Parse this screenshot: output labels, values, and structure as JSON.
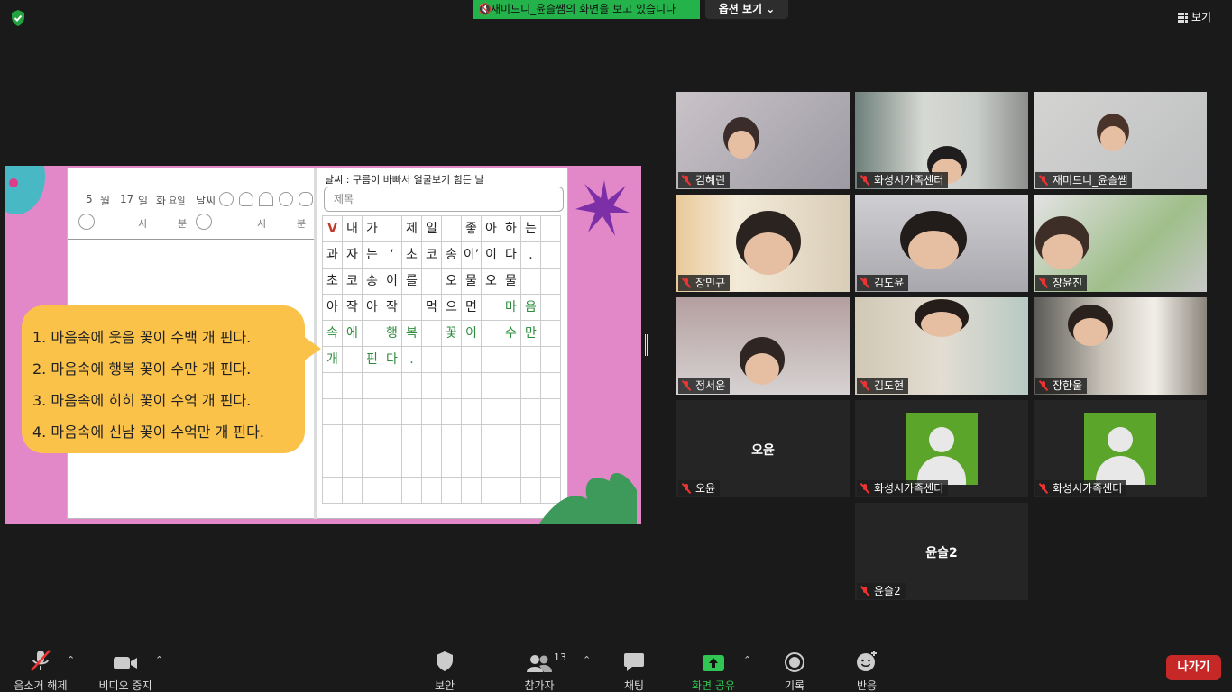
{
  "top": {
    "share_banner": "재미드니_윤슬쌤의 화면을 보고 있습니다",
    "options_label": "옵션 보기 ⌄",
    "view_label": "보기"
  },
  "shared_screen": {
    "left_page": {
      "month": "5",
      "month_unit": "월",
      "day": "17",
      "day_unit": "일",
      "weekday": "화",
      "weekday_unit": "요일",
      "weather_label": "날씨",
      "hour_label": "시",
      "minute_label": "분",
      "hour_label2": "시",
      "minute_label2": "분"
    },
    "right_page": {
      "weather_text": "날씨 :   구름이 바빠서 얼굴보기 힘든 날",
      "title_placeholder": "제목",
      "grid_rows": [
        [
          "V",
          "내",
          "가",
          "",
          "제",
          "일",
          "",
          "좋",
          "아",
          "하",
          "는",
          ""
        ],
        [
          "과",
          "자",
          "는",
          "‘",
          "초",
          "코",
          "송",
          "이’",
          "이",
          "다",
          ".",
          ""
        ],
        [
          "초",
          "코",
          "송",
          "이",
          "를",
          "",
          "오",
          "물",
          "오",
          "물",
          "",
          ""
        ],
        [
          "아",
          "작",
          "아",
          "작",
          "",
          "먹",
          "으",
          "면",
          "",
          "마",
          "음",
          ""
        ],
        [
          "속",
          "에",
          "",
          "행",
          "복",
          "",
          "꽃",
          "이",
          "",
          "수",
          "만",
          ""
        ],
        [
          "개",
          "",
          "핀",
          "다",
          ".",
          "",
          "",
          "",
          "",
          "",
          "",
          ""
        ],
        [
          "",
          "",
          "",
          "",
          "",
          "",
          "",
          "",
          "",
          "",
          "",
          ""
        ],
        [
          "",
          "",
          "",
          "",
          "",
          "",
          "",
          "",
          "",
          "",
          "",
          ""
        ],
        [
          "",
          "",
          "",
          "",
          "",
          "",
          "",
          "",
          "",
          "",
          "",
          ""
        ],
        [
          "",
          "",
          "",
          "",
          "",
          "",
          "",
          "",
          "",
          "",
          "",
          ""
        ],
        [
          "",
          "",
          "",
          "",
          "",
          "",
          "",
          "",
          "",
          "",
          "",
          ""
        ]
      ]
    },
    "bubble_lines": [
      "1.  마음속에 웃음 꽃이 수백 개 핀다.",
      "2. 마음속에 행복 꽃이 수만 개 핀다.",
      "3. 마음속에 히히 꽃이 수억 개 핀다.",
      "4. 마음속에 신남 꽃이 수억만 개 핀다."
    ]
  },
  "participants": [
    {
      "name": "김혜린",
      "video": true
    },
    {
      "name": "화성시가족센터",
      "video": true
    },
    {
      "name": "재미드니_윤슬쌤",
      "video": true,
      "active": true
    },
    {
      "name": "장민규",
      "video": true
    },
    {
      "name": "김도윤",
      "video": true
    },
    {
      "name": "장윤진",
      "video": true
    },
    {
      "name": "정서윤",
      "video": true
    },
    {
      "name": "김도현",
      "video": true
    },
    {
      "name": "장한울",
      "video": true
    },
    {
      "name": "오윤",
      "video": false,
      "center_name": "오윤"
    },
    {
      "name": "화성시가족센터",
      "video": false,
      "avatar": true
    },
    {
      "name": "화성시가족센터",
      "video": false,
      "avatar": true
    },
    {
      "name": "윤슬2",
      "video": false,
      "center_name": "윤슬2"
    }
  ],
  "toolbar": {
    "unmute": "음소거 해제",
    "stop_video": "비디오 중지",
    "security": "보안",
    "participants": "참가자",
    "participants_count": "13",
    "chat": "채팅",
    "share_screen": "화면 공유",
    "record": "기록",
    "reactions": "반응",
    "leave": "나가기"
  },
  "colors": {
    "share_green": "#24b24b",
    "leave_red": "#c62828",
    "active_outline": "#d2e36b",
    "slide_pink": "#e288c9",
    "bubble_yellow": "#fbc24a"
  }
}
